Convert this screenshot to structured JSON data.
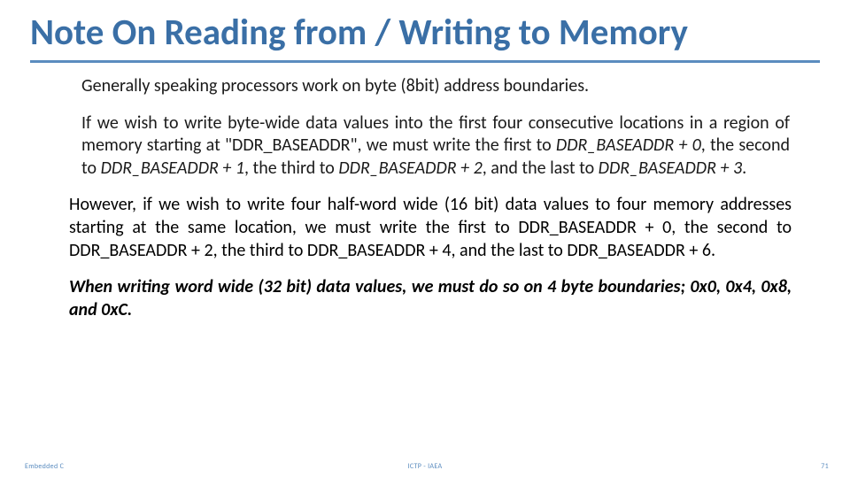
{
  "title": "Note On Reading from / Writing to Memory",
  "p1": "Generally speaking processors work on byte (8bit) address boundaries.",
  "p2_a": "If we wish to write byte-wide data values into the first four consecutive locations in a region of memory starting at \"DDR_BASEADDR\", we must write the first to ",
  "p2_i1": "DDR_BASEADDR + 0",
  "p2_b": ", the second to ",
  "p2_i2": "DDR_BASEADDR + 1",
  "p2_c": ", the third to ",
  "p2_i3": "DDR_BASEADDR + 2",
  "p2_d": ", and the last to ",
  "p2_i4": "DDR_BASEADDR + 3",
  "p2_e": ".",
  "p3": "However, if we wish to write four half-word wide (16 bit) data values to four memory addresses starting at the same location, we must write the first to DDR_BASEADDR + 0, the second to DDR_BASEADDR + 2, the third to DDR_BASEADDR + 4, and the last to DDR_BASEADDR + 6.",
  "p4": "When writing word wide (32 bit) data values, we must do so on 4 byte boundaries; 0x0, 0x4, 0x8, and 0xC.",
  "footer": {
    "left": "Embedded C",
    "center": "ICTP - IAEA",
    "right": "71"
  }
}
